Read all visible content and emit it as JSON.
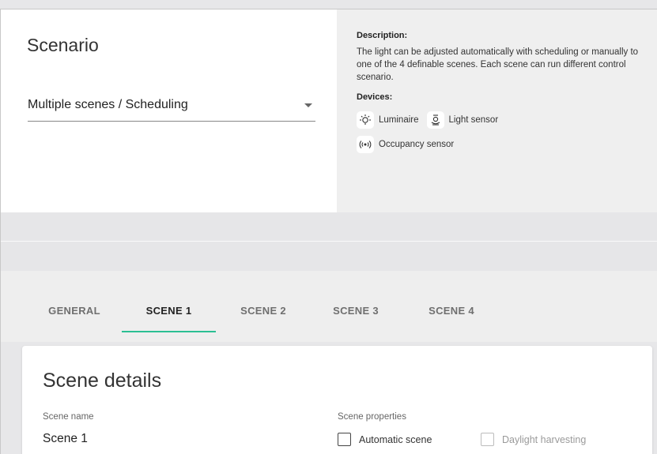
{
  "scenario": {
    "title": "Scenario",
    "selected": "Multiple scenes / Scheduling"
  },
  "description": {
    "heading": "Description:",
    "text": "The light can be adjusted automatically with scheduling or manually to one of the 4 definable scenes. Each scene can run different control scenario.",
    "devices_heading": "Devices:",
    "devices": [
      {
        "label": "Luminaire",
        "icon": "luminaire-icon"
      },
      {
        "label": "Light sensor",
        "icon": "light-sensor-icon"
      },
      {
        "label": "Occupancy sensor",
        "icon": "occupancy-sensor-icon"
      }
    ]
  },
  "tabs": [
    {
      "label": "GENERAL"
    },
    {
      "label": "SCENE 1",
      "active": true
    },
    {
      "label": "SCENE 2"
    },
    {
      "label": "SCENE 3"
    },
    {
      "label": "SCENE 4"
    }
  ],
  "scene_details": {
    "title": "Scene details",
    "name_label": "Scene name",
    "name_value": "Scene 1",
    "properties_label": "Scene properties",
    "automatic_label": "Automatic scene",
    "daylight_label": "Daylight harvesting"
  },
  "colors": {
    "accent": "#2bbf93"
  }
}
